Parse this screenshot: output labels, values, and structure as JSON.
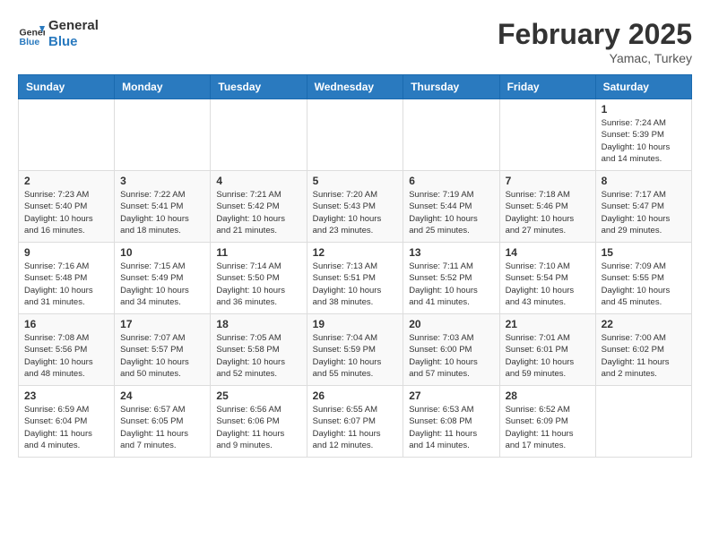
{
  "header": {
    "logo_line1": "General",
    "logo_line2": "Blue",
    "month": "February 2025",
    "location": "Yamac, Turkey"
  },
  "weekdays": [
    "Sunday",
    "Monday",
    "Tuesday",
    "Wednesday",
    "Thursday",
    "Friday",
    "Saturday"
  ],
  "weeks": [
    [
      {
        "day": "",
        "info": ""
      },
      {
        "day": "",
        "info": ""
      },
      {
        "day": "",
        "info": ""
      },
      {
        "day": "",
        "info": ""
      },
      {
        "day": "",
        "info": ""
      },
      {
        "day": "",
        "info": ""
      },
      {
        "day": "1",
        "info": "Sunrise: 7:24 AM\nSunset: 5:39 PM\nDaylight: 10 hours\nand 14 minutes."
      }
    ],
    [
      {
        "day": "2",
        "info": "Sunrise: 7:23 AM\nSunset: 5:40 PM\nDaylight: 10 hours\nand 16 minutes."
      },
      {
        "day": "3",
        "info": "Sunrise: 7:22 AM\nSunset: 5:41 PM\nDaylight: 10 hours\nand 18 minutes."
      },
      {
        "day": "4",
        "info": "Sunrise: 7:21 AM\nSunset: 5:42 PM\nDaylight: 10 hours\nand 21 minutes."
      },
      {
        "day": "5",
        "info": "Sunrise: 7:20 AM\nSunset: 5:43 PM\nDaylight: 10 hours\nand 23 minutes."
      },
      {
        "day": "6",
        "info": "Sunrise: 7:19 AM\nSunset: 5:44 PM\nDaylight: 10 hours\nand 25 minutes."
      },
      {
        "day": "7",
        "info": "Sunrise: 7:18 AM\nSunset: 5:46 PM\nDaylight: 10 hours\nand 27 minutes."
      },
      {
        "day": "8",
        "info": "Sunrise: 7:17 AM\nSunset: 5:47 PM\nDaylight: 10 hours\nand 29 minutes."
      }
    ],
    [
      {
        "day": "9",
        "info": "Sunrise: 7:16 AM\nSunset: 5:48 PM\nDaylight: 10 hours\nand 31 minutes."
      },
      {
        "day": "10",
        "info": "Sunrise: 7:15 AM\nSunset: 5:49 PM\nDaylight: 10 hours\nand 34 minutes."
      },
      {
        "day": "11",
        "info": "Sunrise: 7:14 AM\nSunset: 5:50 PM\nDaylight: 10 hours\nand 36 minutes."
      },
      {
        "day": "12",
        "info": "Sunrise: 7:13 AM\nSunset: 5:51 PM\nDaylight: 10 hours\nand 38 minutes."
      },
      {
        "day": "13",
        "info": "Sunrise: 7:11 AM\nSunset: 5:52 PM\nDaylight: 10 hours\nand 41 minutes."
      },
      {
        "day": "14",
        "info": "Sunrise: 7:10 AM\nSunset: 5:54 PM\nDaylight: 10 hours\nand 43 minutes."
      },
      {
        "day": "15",
        "info": "Sunrise: 7:09 AM\nSunset: 5:55 PM\nDaylight: 10 hours\nand 45 minutes."
      }
    ],
    [
      {
        "day": "16",
        "info": "Sunrise: 7:08 AM\nSunset: 5:56 PM\nDaylight: 10 hours\nand 48 minutes."
      },
      {
        "day": "17",
        "info": "Sunrise: 7:07 AM\nSunset: 5:57 PM\nDaylight: 10 hours\nand 50 minutes."
      },
      {
        "day": "18",
        "info": "Sunrise: 7:05 AM\nSunset: 5:58 PM\nDaylight: 10 hours\nand 52 minutes."
      },
      {
        "day": "19",
        "info": "Sunrise: 7:04 AM\nSunset: 5:59 PM\nDaylight: 10 hours\nand 55 minutes."
      },
      {
        "day": "20",
        "info": "Sunrise: 7:03 AM\nSunset: 6:00 PM\nDaylight: 10 hours\nand 57 minutes."
      },
      {
        "day": "21",
        "info": "Sunrise: 7:01 AM\nSunset: 6:01 PM\nDaylight: 10 hours\nand 59 minutes."
      },
      {
        "day": "22",
        "info": "Sunrise: 7:00 AM\nSunset: 6:02 PM\nDaylight: 11 hours\nand 2 minutes."
      }
    ],
    [
      {
        "day": "23",
        "info": "Sunrise: 6:59 AM\nSunset: 6:04 PM\nDaylight: 11 hours\nand 4 minutes."
      },
      {
        "day": "24",
        "info": "Sunrise: 6:57 AM\nSunset: 6:05 PM\nDaylight: 11 hours\nand 7 minutes."
      },
      {
        "day": "25",
        "info": "Sunrise: 6:56 AM\nSunset: 6:06 PM\nDaylight: 11 hours\nand 9 minutes."
      },
      {
        "day": "26",
        "info": "Sunrise: 6:55 AM\nSunset: 6:07 PM\nDaylight: 11 hours\nand 12 minutes."
      },
      {
        "day": "27",
        "info": "Sunrise: 6:53 AM\nSunset: 6:08 PM\nDaylight: 11 hours\nand 14 minutes."
      },
      {
        "day": "28",
        "info": "Sunrise: 6:52 AM\nSunset: 6:09 PM\nDaylight: 11 hours\nand 17 minutes."
      },
      {
        "day": "",
        "info": ""
      }
    ]
  ]
}
